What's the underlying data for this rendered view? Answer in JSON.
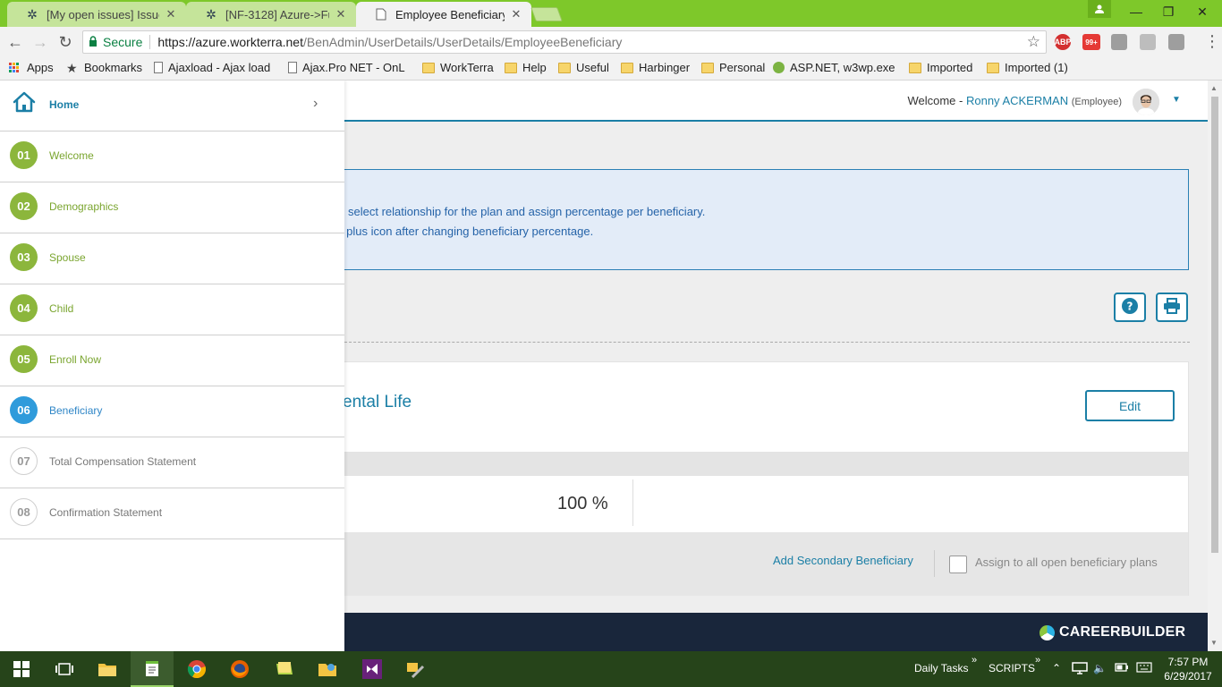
{
  "browser": {
    "tabs": [
      {
        "title": "[My open issues] Issue",
        "active": false
      },
      {
        "title": "[NF-3128] Azure->Fun",
        "active": false
      },
      {
        "title": "Employee Beneficiary",
        "active": true
      }
    ],
    "secure_label": "Secure",
    "url_host": "https://azure.workterra.net",
    "url_path": "/BenAdmin/UserDetails/UserDetails/EmployeeBeneficiary",
    "ext_abp": "ABP",
    "ext_badge": "99+",
    "bookmarks": [
      {
        "label": "Apps",
        "icon": "apps-grid-icon"
      },
      {
        "label": "Bookmarks",
        "icon": "star-icon"
      },
      {
        "label": "Ajaxload - Ajax load",
        "icon": "page-icon"
      },
      {
        "label": "Ajax.Pro NET - OnL",
        "icon": "page-icon"
      },
      {
        "label": "WorkTerra",
        "icon": "folder-icon"
      },
      {
        "label": "Help",
        "icon": "folder-icon"
      },
      {
        "label": "Useful",
        "icon": "folder-icon"
      },
      {
        "label": "Harbinger",
        "icon": "folder-icon"
      },
      {
        "label": "Personal",
        "icon": "folder-icon"
      },
      {
        "label": "ASP.NET, w3wp.exe,",
        "icon": "globe-icon"
      },
      {
        "label": "Imported",
        "icon": "folder-icon"
      },
      {
        "label": "Imported (1)",
        "icon": "folder-icon"
      }
    ]
  },
  "header": {
    "welcome_prefix": "Welcome -",
    "user_name": "Ronny ACKERMAN",
    "user_role": "(Employee)"
  },
  "sidebar": {
    "home_label": "Home",
    "steps": [
      {
        "num": "01",
        "label": "Welcome",
        "state": "done"
      },
      {
        "num": "02",
        "label": "Demographics",
        "state": "done"
      },
      {
        "num": "03",
        "label": "Spouse",
        "state": "done"
      },
      {
        "num": "04",
        "label": "Child",
        "state": "done"
      },
      {
        "num": "05",
        "label": "Enroll Now",
        "state": "done"
      },
      {
        "num": "06",
        "label": "Beneficiary",
        "state": "current"
      },
      {
        "num": "07",
        "label": "Total Compensation Statement",
        "state": "todo"
      },
      {
        "num": "08",
        "label": "Confirmation Statement",
        "state": "todo"
      }
    ]
  },
  "main": {
    "info_line1": "select relationship for the plan and assign percentage per beneficiary.",
    "info_line2": "k plus icon after changing beneficiary percentage.",
    "plan_title": "ental Life",
    "edit_label": "Edit",
    "percent": "100 %",
    "add_secondary": "Add Secondary Beneficiary",
    "assign_all_label": "Assign to all open beneficiary plans"
  },
  "footer": {
    "brand": "CAREERBUILDER"
  },
  "taskbar": {
    "daily_tasks": "Daily Tasks",
    "scripts": "SCRIPTS",
    "time": "7:57 PM",
    "date": "6/29/2017"
  },
  "colors": {
    "accent": "#1b7fa6",
    "step_done": "#8cb63c",
    "step_current": "#2f9bdb",
    "chrome_green": "#7ec82a",
    "footer_navy": "#19263b"
  }
}
